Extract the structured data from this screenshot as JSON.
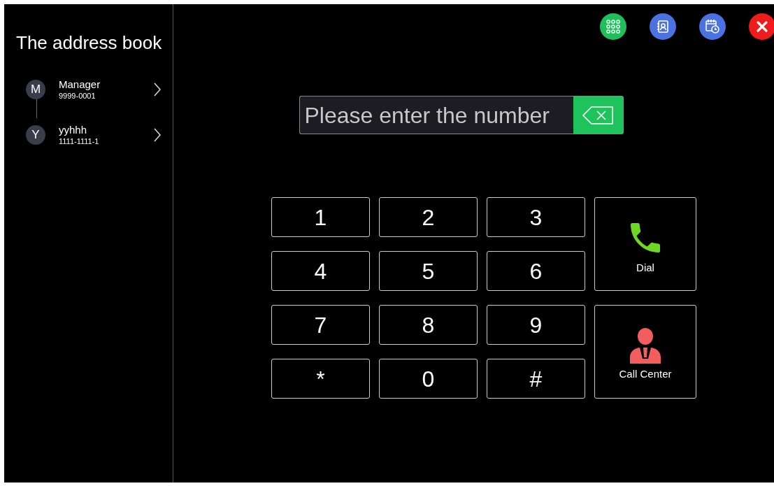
{
  "sidebar": {
    "title": "The address book",
    "contacts": [
      {
        "initial": "M",
        "name": "Manager",
        "number": "9999-0001"
      },
      {
        "initial": "Y",
        "name": "yyhhh",
        "number": "1111-1111-1"
      }
    ]
  },
  "toolbar": [
    {
      "kind": "keypad",
      "color": "#1fbf5c"
    },
    {
      "kind": "contacts",
      "color": "#4a72e0"
    },
    {
      "kind": "history",
      "color": "#4a72e0"
    },
    {
      "kind": "close",
      "color": "#f01c1c"
    }
  ],
  "number_field": {
    "placeholder": "Please enter the number"
  },
  "keys": [
    "1",
    "2",
    "3",
    "4",
    "5",
    "6",
    "7",
    "8",
    "9",
    "*",
    "0",
    "#"
  ],
  "actions": [
    {
      "kind": "dial",
      "label": "Dial"
    },
    {
      "kind": "call_center",
      "label": "Call Center"
    }
  ]
}
